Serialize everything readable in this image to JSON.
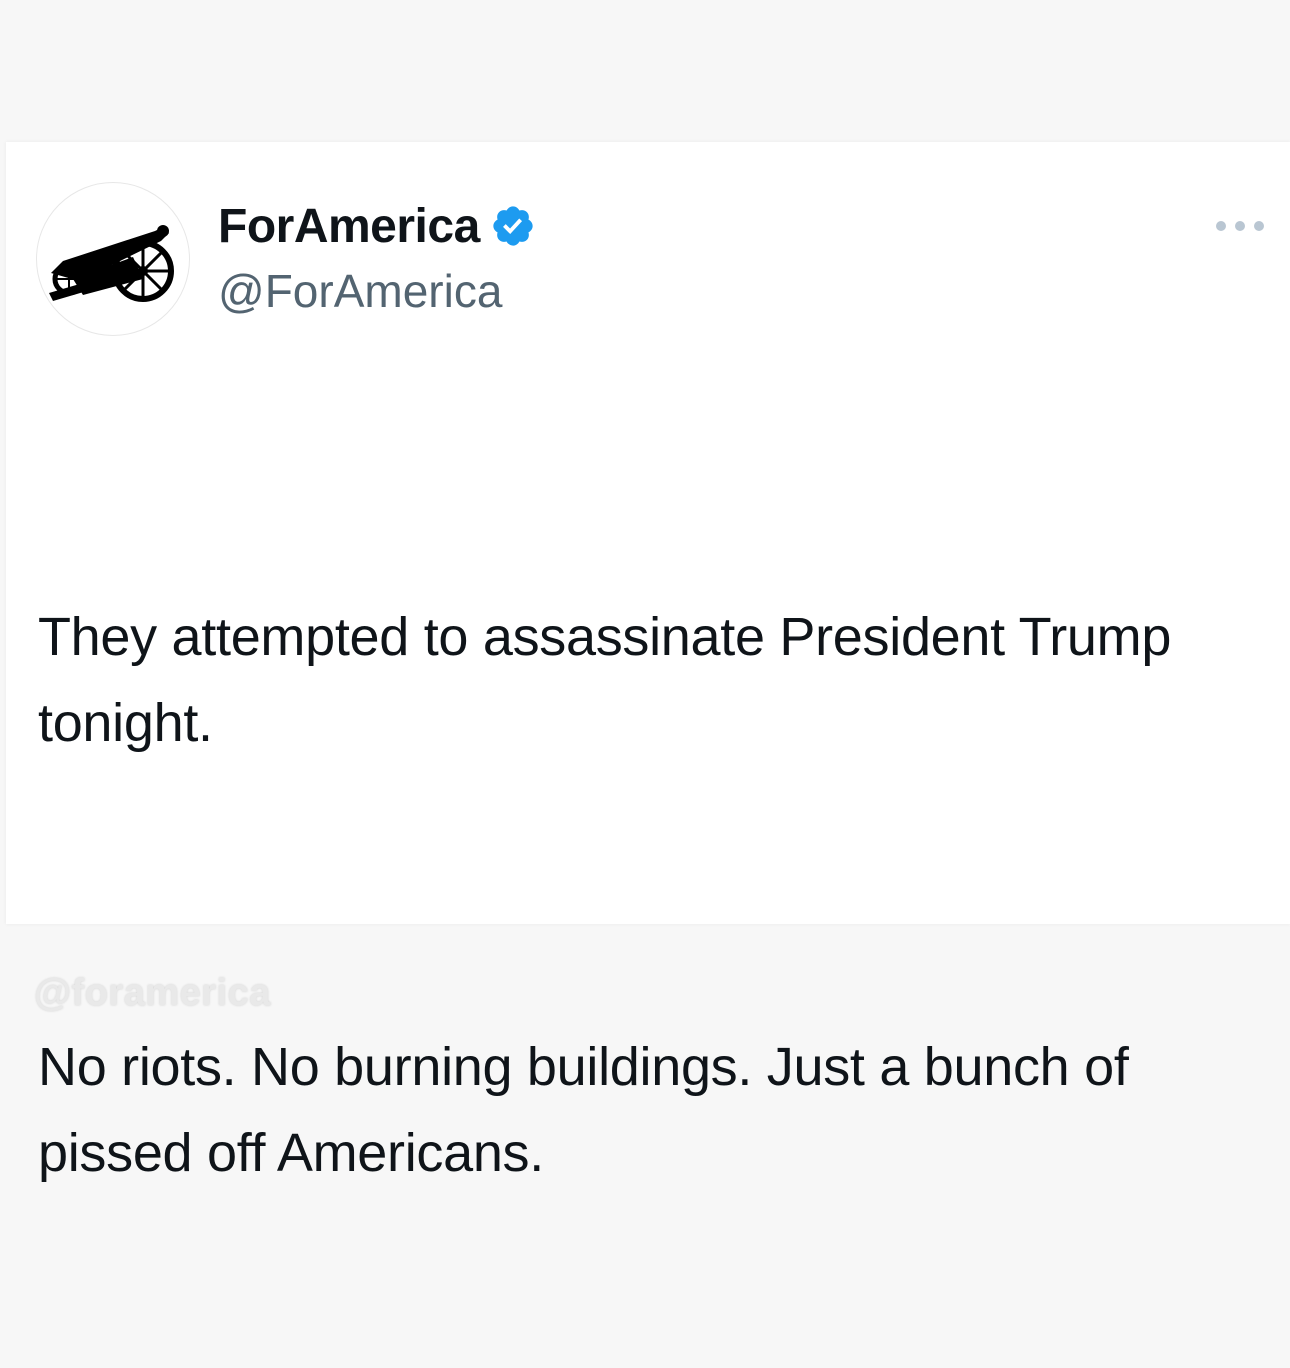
{
  "tweet": {
    "display_name": "ForAmerica",
    "handle": "@ForAmerica",
    "verified": true,
    "avatar_icon": "cannon-icon",
    "more_icon": "more-options-icon",
    "text_paragraph_1": "They attempted to assassinate President Trump tonight.",
    "text_paragraph_2": "No riots. No burning buildings. Just a bunch of pissed off Americans."
  },
  "watermark": "@foramerica",
  "colors": {
    "verified_blue": "#1d9bf0",
    "text": "#0f1419",
    "secondary_text": "#536471",
    "background": "#f7f7f7",
    "card": "#ffffff"
  }
}
